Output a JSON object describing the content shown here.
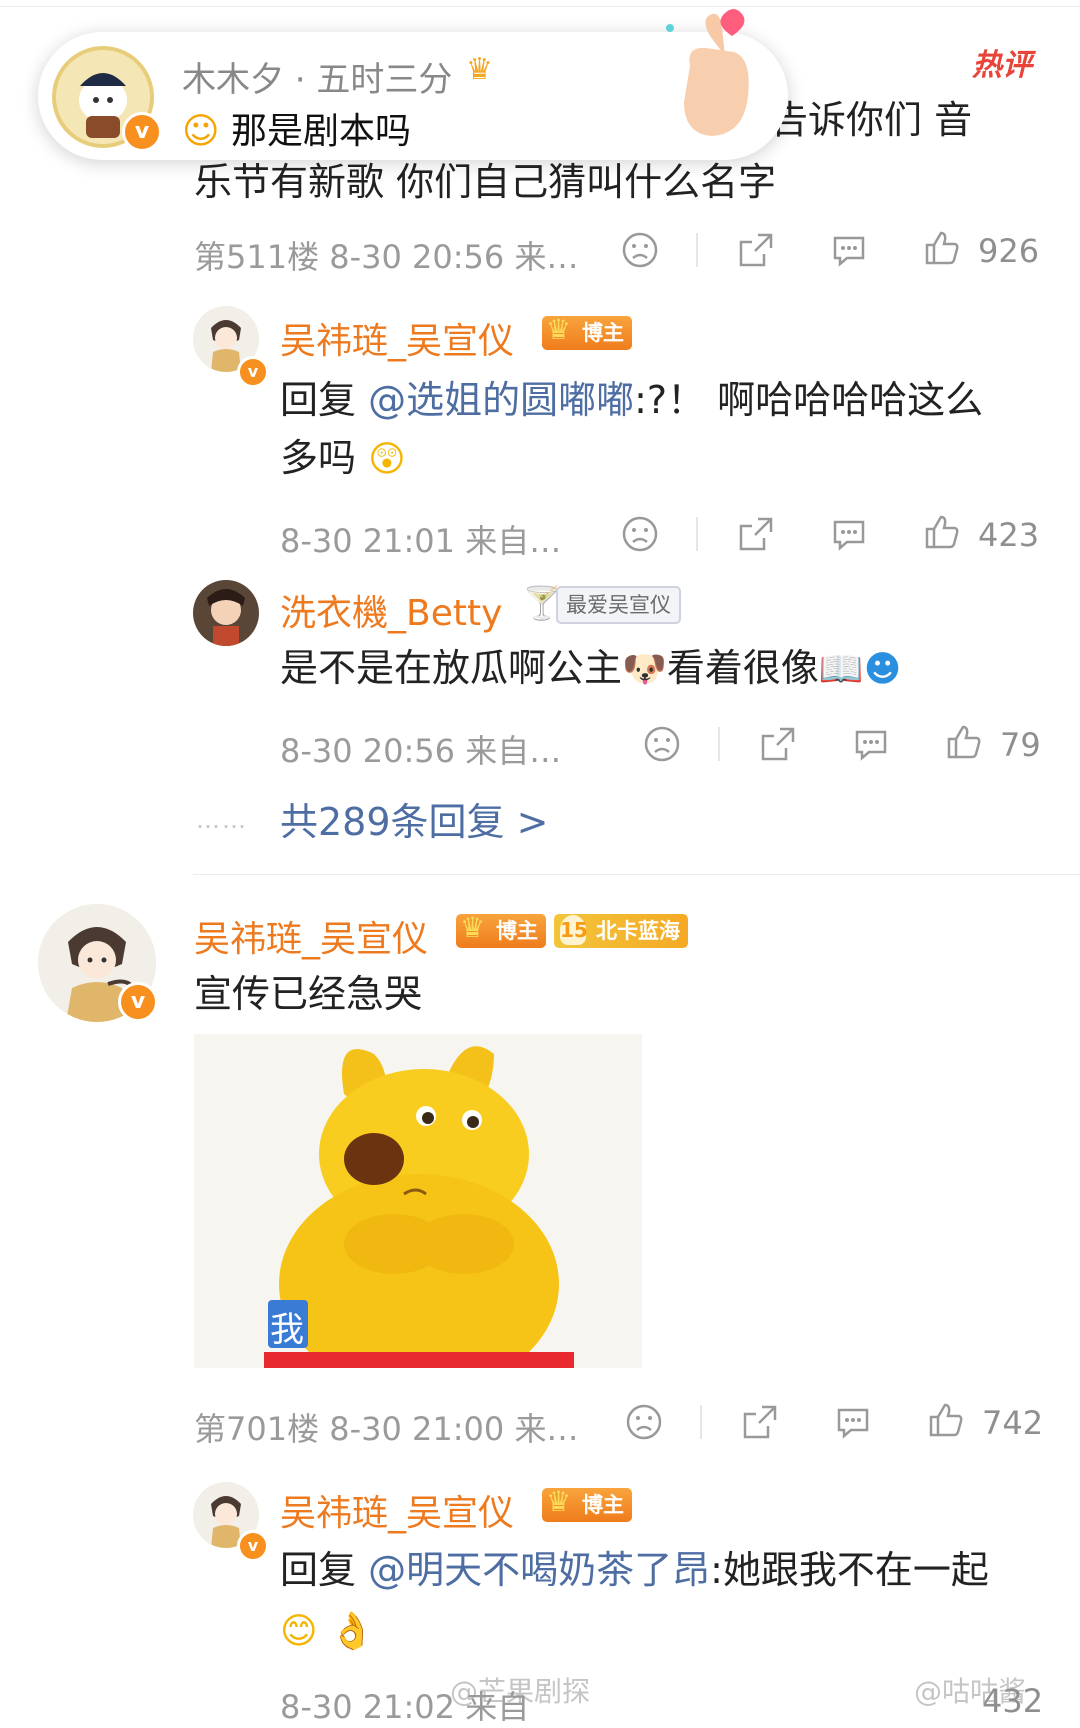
{
  "notification": {
    "sender": "木木夕 · 五时三分",
    "message": "那是剧本吗",
    "crown_icon": "crown-icon",
    "heart_hand_icon": "finger-heart-icon"
  },
  "hot_label": "热评",
  "comment1": {
    "text_line1_hidden_part": "告诉你们 音",
    "text_line2": "乐节有新歌 你们自己猜叫什么名字",
    "meta": "第511楼 8-30 20:56 来…",
    "likes": "926"
  },
  "reply1": {
    "username": "吴祎琏_吴宣仪",
    "badge": "博主",
    "prefix": "回复 ",
    "mention": "@选姐的圆嘟嘟",
    "text_line1": ":?！ 啊哈哈哈哈这么",
    "text_line2": "多吗",
    "meta": "8-30 21:01 来自…",
    "likes": "423"
  },
  "reply2": {
    "username": "洗衣機_Betty",
    "badge": "最爱吴宣仪",
    "text": "是不是在放瓜啊公主",
    "text2": "看着很像",
    "meta": "8-30 20:56 来自…",
    "likes": "79"
  },
  "more_replies": {
    "dots": "……",
    "label": "共289条回复 >"
  },
  "comment2": {
    "username": "吴祎琏_吴宣仪",
    "badge": "博主",
    "fan_level": "15",
    "fan_badge": "北卡蓝海",
    "text": "宣传已经急哭",
    "image_caption_tag": "我",
    "meta": "第701楼 8-30 21:00 来…",
    "likes": "742"
  },
  "reply3": {
    "username": "吴祎琏_吴宣仪",
    "badge": "博主",
    "prefix": "回复 ",
    "mention": "@明天不喝奶茶了昂",
    "text": ":她跟我不在一起",
    "meta": "8-30 21:02 来自",
    "likes": "432"
  },
  "watermarks": {
    "left": "@芒果剧探",
    "right": "@咕咕酱"
  },
  "colors": {
    "username": "#ee7a1f",
    "link": "#4e6ea3",
    "hot": "#e8443a",
    "badge": "#ef7c1c"
  }
}
